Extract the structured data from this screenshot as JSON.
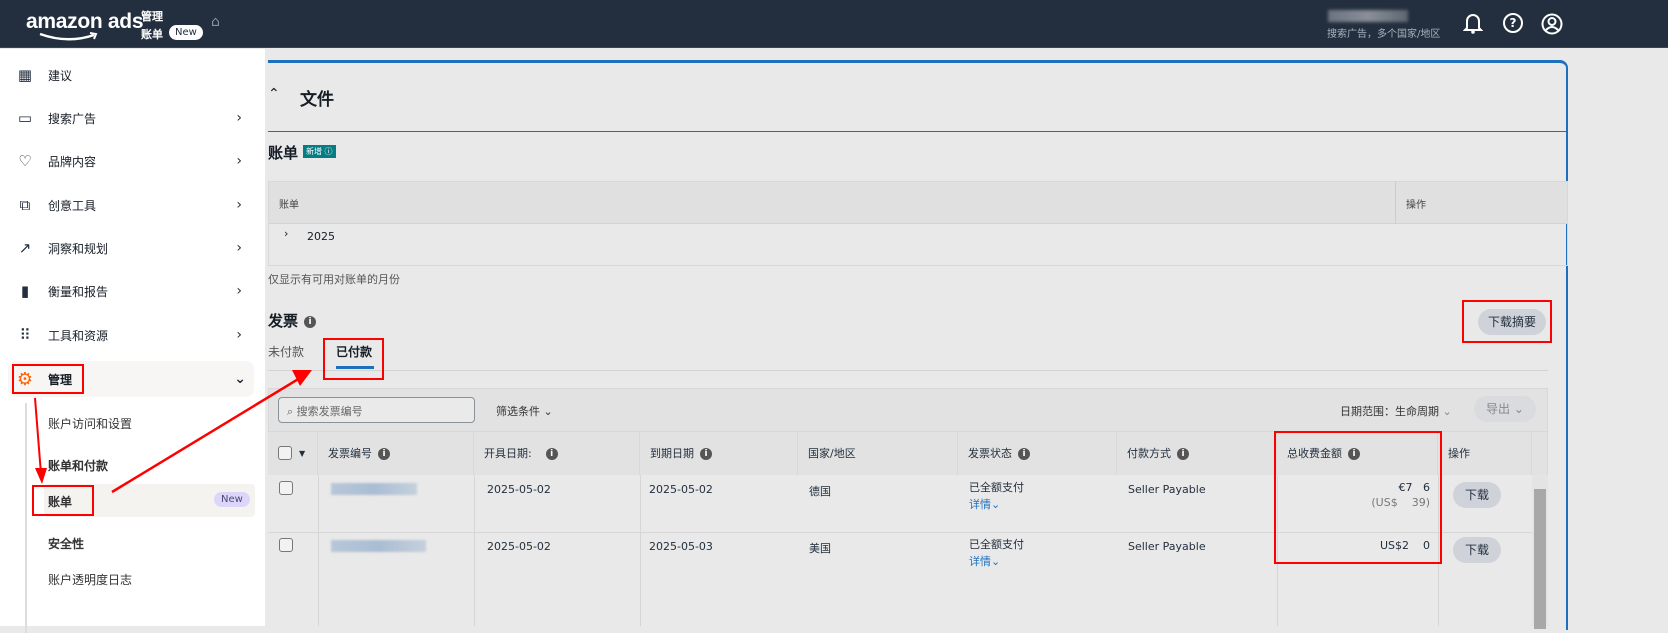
{
  "header": {
    "logo": "amazon ads",
    "crumb_parent": "管理",
    "crumb_current": "账单",
    "new_badge": "New",
    "account_scope": "搜索广告，多个国家/地区"
  },
  "sidebar": {
    "items": [
      {
        "label": "建议",
        "icon": "grid-icon"
      },
      {
        "label": "搜索广告",
        "icon": "ad-card-icon"
      },
      {
        "label": "品牌内容",
        "icon": "shield-heart-icon"
      },
      {
        "label": "创意工具",
        "icon": "image-stack-icon"
      },
      {
        "label": "洞察和规划",
        "icon": "trend-icon"
      },
      {
        "label": "衡量和报告",
        "icon": "bar-chart-icon"
      },
      {
        "label": "工具和资源",
        "icon": "dots-grid-icon"
      },
      {
        "label": "管理",
        "icon": "gear-icon"
      }
    ],
    "sub_items": [
      "账户访问和设置",
      "账单和付款",
      "账单",
      "安全性",
      "账户透明度日志"
    ],
    "sub_new": "New"
  },
  "files": {
    "title": "文件"
  },
  "statements": {
    "title": "账单",
    "badge": "新增",
    "col_statement": "账单",
    "col_action": "操作",
    "row_year": "2025",
    "note": "仅显示有可用对账单的月份"
  },
  "invoices": {
    "title": "发票",
    "download_summary": "下载摘要",
    "tabs": [
      "未付款",
      "已付款"
    ],
    "search_placeholder": "搜索发票编号",
    "filter": "筛选条件",
    "date_range": "日期范围：生命周期",
    "export": "导出",
    "columns": [
      "发票编号",
      "开具日期:",
      "到期日期",
      "国家/地区",
      "发票状态",
      "付款方式",
      "总收费金额",
      "操作"
    ],
    "rows": [
      {
        "issue": "2025-05-02",
        "due": "2025-05-02",
        "country": "德国",
        "status": "已全额支付",
        "details": "详情",
        "method": "Seller Payable",
        "amount": "€7   6",
        "amount_usd": "(US$    39)",
        "action": "下载"
      },
      {
        "issue": "2025-05-02",
        "due": "2025-05-03",
        "country": "美国",
        "status": "已全额支付",
        "details": "详情",
        "method": "Seller Payable",
        "amount": "US$2    0",
        "action": "下载"
      }
    ]
  },
  "colors": {
    "header": "#232f3e",
    "accent": "#1f6fbf",
    "annotation": "#ff0000",
    "gear": "#ff6200"
  }
}
